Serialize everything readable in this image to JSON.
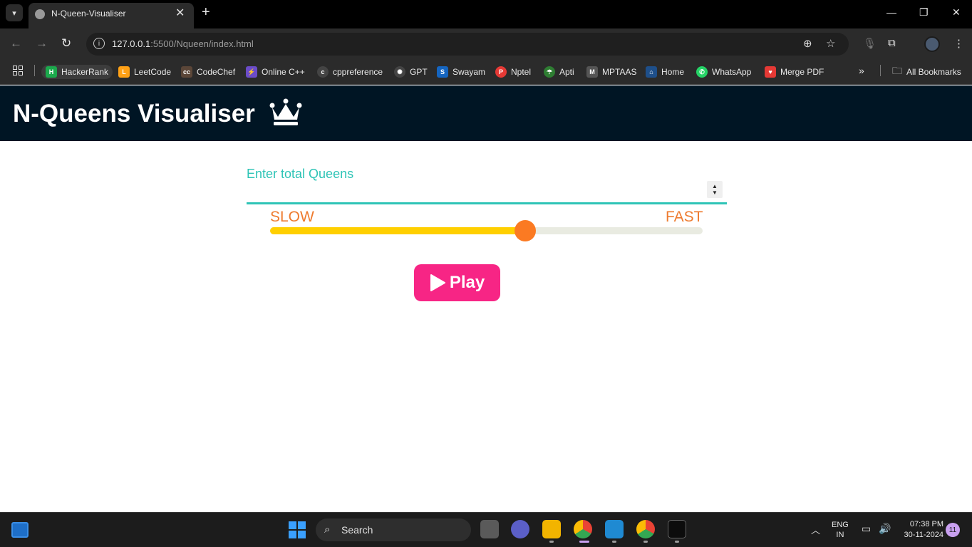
{
  "browser": {
    "tab_title": "N-Queen-Visualiser",
    "url_host": "127.0.0.1",
    "url_rest": ":5500/Nqueen/index.html",
    "bookmarks": [
      {
        "label": "HackerRank",
        "icon": "hackerrank-icon",
        "color": "#1ba94c"
      },
      {
        "label": "LeetCode",
        "icon": "leetcode-icon",
        "color": "#ffa116"
      },
      {
        "label": "CodeChef",
        "icon": "codechef-icon",
        "color": "#5b4638"
      },
      {
        "label": "Online C++",
        "icon": "bolt-icon",
        "color": "#6b4cc8"
      },
      {
        "label": "cppreference",
        "icon": "cppreference-icon",
        "color": "#444444"
      },
      {
        "label": "GPT",
        "icon": "openai-icon",
        "color": "#444444"
      },
      {
        "label": "Swayam",
        "icon": "swayam-icon",
        "color": "#1565c0"
      },
      {
        "label": "Nptel",
        "icon": "nptel-icon",
        "color": "#e53935"
      },
      {
        "label": "Apti",
        "icon": "apti-icon",
        "color": "#2e7d32"
      },
      {
        "label": "MPTAAS",
        "icon": "mptaas-icon",
        "color": "#555555"
      },
      {
        "label": "Home",
        "icon": "home-icon",
        "color": "#1e4f8a"
      },
      {
        "label": "WhatsApp",
        "icon": "whatsapp-icon",
        "color": "#25d366"
      },
      {
        "label": "Merge PDF",
        "icon": "mergepdf-icon",
        "color": "#e53935"
      }
    ],
    "all_bookmarks": "All Bookmarks"
  },
  "page": {
    "title": "N-Queens Visualiser",
    "header_bg": "#001524",
    "queens_label": "Enter total Queens",
    "queens_value": "",
    "speed_slow": "SLOW",
    "speed_fast": "FAST",
    "speed_level": 0.59,
    "play_label": "Play",
    "accent_teal": "#2ec4b6",
    "accent_orange": "#ee7b2f",
    "accent_pink": "#f72585"
  },
  "taskbar": {
    "search_label": "Search",
    "lang_top": "ENG",
    "lang_bottom": "IN",
    "time": "07:38 PM",
    "date": "30-11-2024",
    "notification_count": "11"
  }
}
